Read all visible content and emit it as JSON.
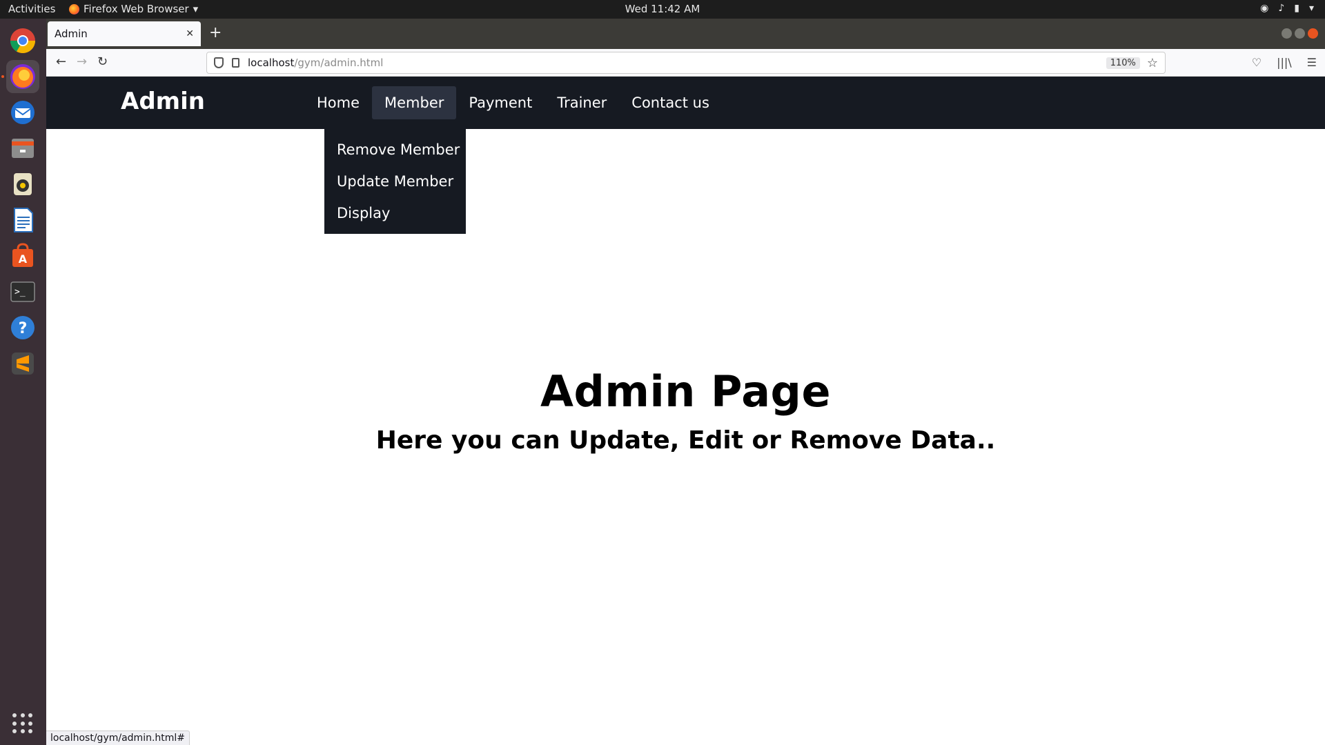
{
  "os": {
    "activities": "Activities",
    "app_name": "Firefox Web Browser",
    "clock": "Wed 11:42 AM"
  },
  "browser": {
    "tab_title": "Admin",
    "url_host": "localhost",
    "url_path": "/gym/admin.html",
    "zoom": "110%",
    "status_url": "localhost/gym/admin.html#"
  },
  "site": {
    "brand": "Admin",
    "menu": [
      "Home",
      "Member",
      "Payment",
      "Trainer",
      "Contact us"
    ],
    "active_menu": "Member",
    "dropdown": [
      "Remove Member",
      "Update Member",
      "Display"
    ],
    "heading": "Admin Page",
    "subheading": "Here you can Update, Edit or Remove Data.."
  },
  "colors": {
    "nav_bg": "#161a22",
    "nav_active": "#2c3240",
    "ubuntu_accent": "#e95420"
  },
  "dock_icons": [
    "chrome-icon",
    "firefox-icon",
    "thunderbird-icon",
    "files-icon",
    "rhythmbox-icon",
    "writer-icon",
    "software-center-icon",
    "terminal-icon",
    "help-icon",
    "sublime-icon"
  ]
}
